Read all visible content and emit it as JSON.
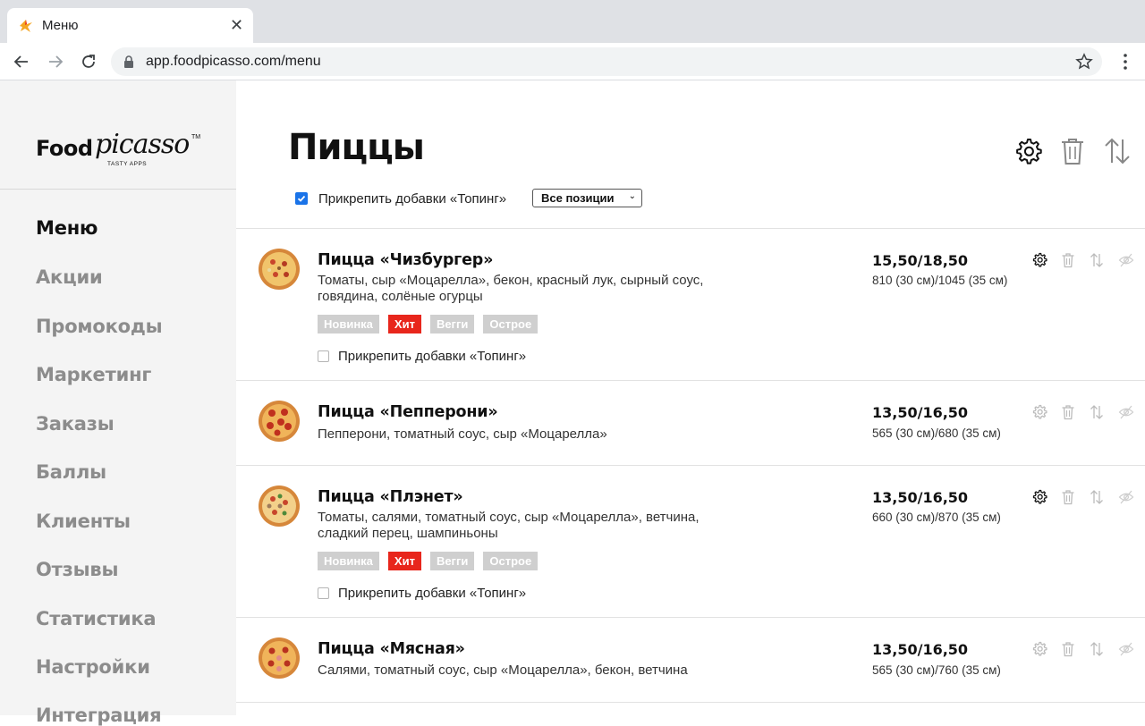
{
  "browser": {
    "tab_title": "Меню",
    "url": "app.foodpicasso.com/menu"
  },
  "logo": {
    "food": "Food",
    "picasso": "picasso",
    "tm": "TM",
    "sub": "TASTY APPS"
  },
  "sidebar": {
    "items": [
      {
        "label": "Меню",
        "active": true
      },
      {
        "label": "Акции"
      },
      {
        "label": "Промокоды"
      },
      {
        "label": "Маркетинг"
      },
      {
        "label": "Заказы"
      },
      {
        "label": "Баллы"
      },
      {
        "label": "Клиенты"
      },
      {
        "label": "Отзывы"
      },
      {
        "label": "Статистика"
      },
      {
        "label": "Настройки"
      },
      {
        "label": "Интеграция"
      }
    ]
  },
  "main": {
    "title": "Пиццы",
    "pin_label": "Прикрепить добавки «Топинг»",
    "pin_checked": true,
    "filter_value": "Все позиции",
    "tags": [
      "Новинка",
      "Хит",
      "Вегги",
      "Острое"
    ],
    "items": [
      {
        "title": "Пицца «Чизбургер»",
        "desc": "Томаты, сыр «Моцарелла», бекон, красный лук, сырный соус, говядина, солёные огурцы",
        "price": "15,50/18,50",
        "weight": "810 (30 см)/1045 (35 см)",
        "pin_label": "Прикрепить добавки «Топинг»"
      },
      {
        "title": "Пицца «Пепперони»",
        "desc": "Пепперони, томатный соус, сыр «Моцарелла»",
        "price": "13,50/16,50",
        "weight": "565 (30 см)/680 (35 см)"
      },
      {
        "title": "Пицца «Плэнет»",
        "desc": "Томаты, салями, томатный соус, сыр «Моцарелла», ветчина, сладкий перец, шампиньоны",
        "price": "13,50/16,50",
        "weight": "660 (30 см)/870 (35 см)",
        "pin_label": "Прикрепить добавки «Топинг»"
      },
      {
        "title": "Пицца «Мясная»",
        "desc": "Салями, томатный соус, сыр «Моцарелла», бекон, ветчина",
        "price": "13,50/16,50",
        "weight": "565 (30 см)/760 (35 см)"
      }
    ]
  },
  "colors": {
    "hot_tag": "#e8261c",
    "inactive_tag": "#cfcfcf",
    "sidebar_bg": "#f4f4f4",
    "checkbox": "#1a73e8"
  }
}
